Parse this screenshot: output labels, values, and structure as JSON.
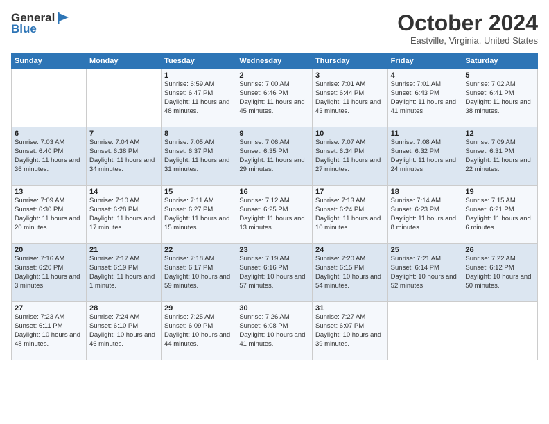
{
  "header": {
    "logo_line1": "General",
    "logo_line2": "Blue",
    "month_title": "October 2024",
    "location": "Eastville, Virginia, United States"
  },
  "weekdays": [
    "Sunday",
    "Monday",
    "Tuesday",
    "Wednesday",
    "Thursday",
    "Friday",
    "Saturday"
  ],
  "weeks": [
    [
      {
        "day": "",
        "info": ""
      },
      {
        "day": "",
        "info": ""
      },
      {
        "day": "1",
        "info": "Sunrise: 6:59 AM\nSunset: 6:47 PM\nDaylight: 11 hours and 48 minutes."
      },
      {
        "day": "2",
        "info": "Sunrise: 7:00 AM\nSunset: 6:46 PM\nDaylight: 11 hours and 45 minutes."
      },
      {
        "day": "3",
        "info": "Sunrise: 7:01 AM\nSunset: 6:44 PM\nDaylight: 11 hours and 43 minutes."
      },
      {
        "day": "4",
        "info": "Sunrise: 7:01 AM\nSunset: 6:43 PM\nDaylight: 11 hours and 41 minutes."
      },
      {
        "day": "5",
        "info": "Sunrise: 7:02 AM\nSunset: 6:41 PM\nDaylight: 11 hours and 38 minutes."
      }
    ],
    [
      {
        "day": "6",
        "info": "Sunrise: 7:03 AM\nSunset: 6:40 PM\nDaylight: 11 hours and 36 minutes."
      },
      {
        "day": "7",
        "info": "Sunrise: 7:04 AM\nSunset: 6:38 PM\nDaylight: 11 hours and 34 minutes."
      },
      {
        "day": "8",
        "info": "Sunrise: 7:05 AM\nSunset: 6:37 PM\nDaylight: 11 hours and 31 minutes."
      },
      {
        "day": "9",
        "info": "Sunrise: 7:06 AM\nSunset: 6:35 PM\nDaylight: 11 hours and 29 minutes."
      },
      {
        "day": "10",
        "info": "Sunrise: 7:07 AM\nSunset: 6:34 PM\nDaylight: 11 hours and 27 minutes."
      },
      {
        "day": "11",
        "info": "Sunrise: 7:08 AM\nSunset: 6:32 PM\nDaylight: 11 hours and 24 minutes."
      },
      {
        "day": "12",
        "info": "Sunrise: 7:09 AM\nSunset: 6:31 PM\nDaylight: 11 hours and 22 minutes."
      }
    ],
    [
      {
        "day": "13",
        "info": "Sunrise: 7:09 AM\nSunset: 6:30 PM\nDaylight: 11 hours and 20 minutes."
      },
      {
        "day": "14",
        "info": "Sunrise: 7:10 AM\nSunset: 6:28 PM\nDaylight: 11 hours and 17 minutes."
      },
      {
        "day": "15",
        "info": "Sunrise: 7:11 AM\nSunset: 6:27 PM\nDaylight: 11 hours and 15 minutes."
      },
      {
        "day": "16",
        "info": "Sunrise: 7:12 AM\nSunset: 6:25 PM\nDaylight: 11 hours and 13 minutes."
      },
      {
        "day": "17",
        "info": "Sunrise: 7:13 AM\nSunset: 6:24 PM\nDaylight: 11 hours and 10 minutes."
      },
      {
        "day": "18",
        "info": "Sunrise: 7:14 AM\nSunset: 6:23 PM\nDaylight: 11 hours and 8 minutes."
      },
      {
        "day": "19",
        "info": "Sunrise: 7:15 AM\nSunset: 6:21 PM\nDaylight: 11 hours and 6 minutes."
      }
    ],
    [
      {
        "day": "20",
        "info": "Sunrise: 7:16 AM\nSunset: 6:20 PM\nDaylight: 11 hours and 3 minutes."
      },
      {
        "day": "21",
        "info": "Sunrise: 7:17 AM\nSunset: 6:19 PM\nDaylight: 11 hours and 1 minute."
      },
      {
        "day": "22",
        "info": "Sunrise: 7:18 AM\nSunset: 6:17 PM\nDaylight: 10 hours and 59 minutes."
      },
      {
        "day": "23",
        "info": "Sunrise: 7:19 AM\nSunset: 6:16 PM\nDaylight: 10 hours and 57 minutes."
      },
      {
        "day": "24",
        "info": "Sunrise: 7:20 AM\nSunset: 6:15 PM\nDaylight: 10 hours and 54 minutes."
      },
      {
        "day": "25",
        "info": "Sunrise: 7:21 AM\nSunset: 6:14 PM\nDaylight: 10 hours and 52 minutes."
      },
      {
        "day": "26",
        "info": "Sunrise: 7:22 AM\nSunset: 6:12 PM\nDaylight: 10 hours and 50 minutes."
      }
    ],
    [
      {
        "day": "27",
        "info": "Sunrise: 7:23 AM\nSunset: 6:11 PM\nDaylight: 10 hours and 48 minutes."
      },
      {
        "day": "28",
        "info": "Sunrise: 7:24 AM\nSunset: 6:10 PM\nDaylight: 10 hours and 46 minutes."
      },
      {
        "day": "29",
        "info": "Sunrise: 7:25 AM\nSunset: 6:09 PM\nDaylight: 10 hours and 44 minutes."
      },
      {
        "day": "30",
        "info": "Sunrise: 7:26 AM\nSunset: 6:08 PM\nDaylight: 10 hours and 41 minutes."
      },
      {
        "day": "31",
        "info": "Sunrise: 7:27 AM\nSunset: 6:07 PM\nDaylight: 10 hours and 39 minutes."
      },
      {
        "day": "",
        "info": ""
      },
      {
        "day": "",
        "info": ""
      }
    ]
  ]
}
